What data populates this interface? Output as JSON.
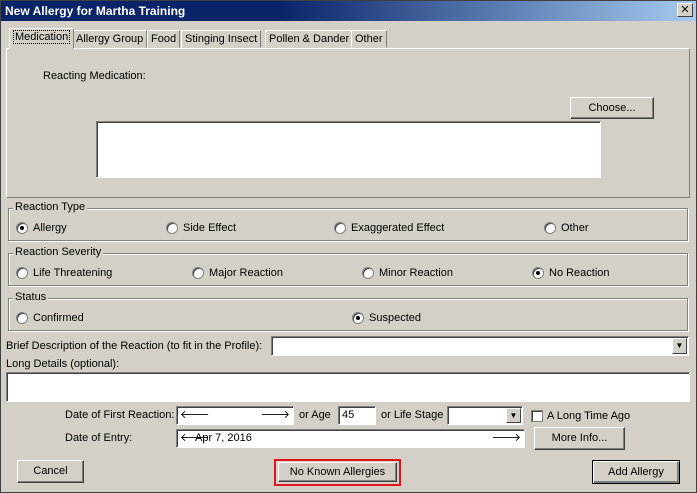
{
  "window": {
    "title": "New Allergy for Martha Training",
    "close_glyph": "✕"
  },
  "tabs": [
    {
      "label": "Medication",
      "active": true
    },
    {
      "label": "Allergy Group"
    },
    {
      "label": "Food"
    },
    {
      "label": "Stinging Insect"
    },
    {
      "label": "Pollen & Dander"
    },
    {
      "label": "Other"
    }
  ],
  "medication": {
    "reacting_label": "Reacting Medication:",
    "choose_label": "Choose...",
    "selected_value": ""
  },
  "reaction_type": {
    "label": "Reaction Type",
    "options": [
      "Allergy",
      "Side Effect",
      "Exaggerated Effect",
      "Other"
    ],
    "selected": "Allergy"
  },
  "reaction_severity": {
    "label": "Reaction Severity",
    "options": [
      "Life Threatening",
      "Major Reaction",
      "Minor Reaction",
      "No Reaction"
    ],
    "selected": "No Reaction"
  },
  "status": {
    "label": "Status",
    "options": [
      "Confirmed",
      "Suspected"
    ],
    "selected": "Suspected"
  },
  "details": {
    "brief_label": "Brief Description of the Reaction (to fit in the Profile):",
    "brief_value": "",
    "long_label": "Long Details (optional):",
    "long_value": ""
  },
  "dates": {
    "first_reaction_label": "Date of First Reaction:",
    "first_reaction_value": "",
    "or_age_label": "or Age",
    "age_value": "45",
    "or_life_stage_label": "or Life Stage",
    "life_stage_value": "",
    "long_time_ago_label": "A Long Time Ago",
    "entry_label": "Date of Entry:",
    "entry_value": "Apr 7, 2016",
    "more_info_label": "More Info..."
  },
  "footer": {
    "cancel_label": "Cancel",
    "nka_label": "No Known Allergies",
    "add_label": "Add Allergy"
  },
  "colors": {
    "title_bar": "#0a246a",
    "highlight": "#e0161c"
  }
}
